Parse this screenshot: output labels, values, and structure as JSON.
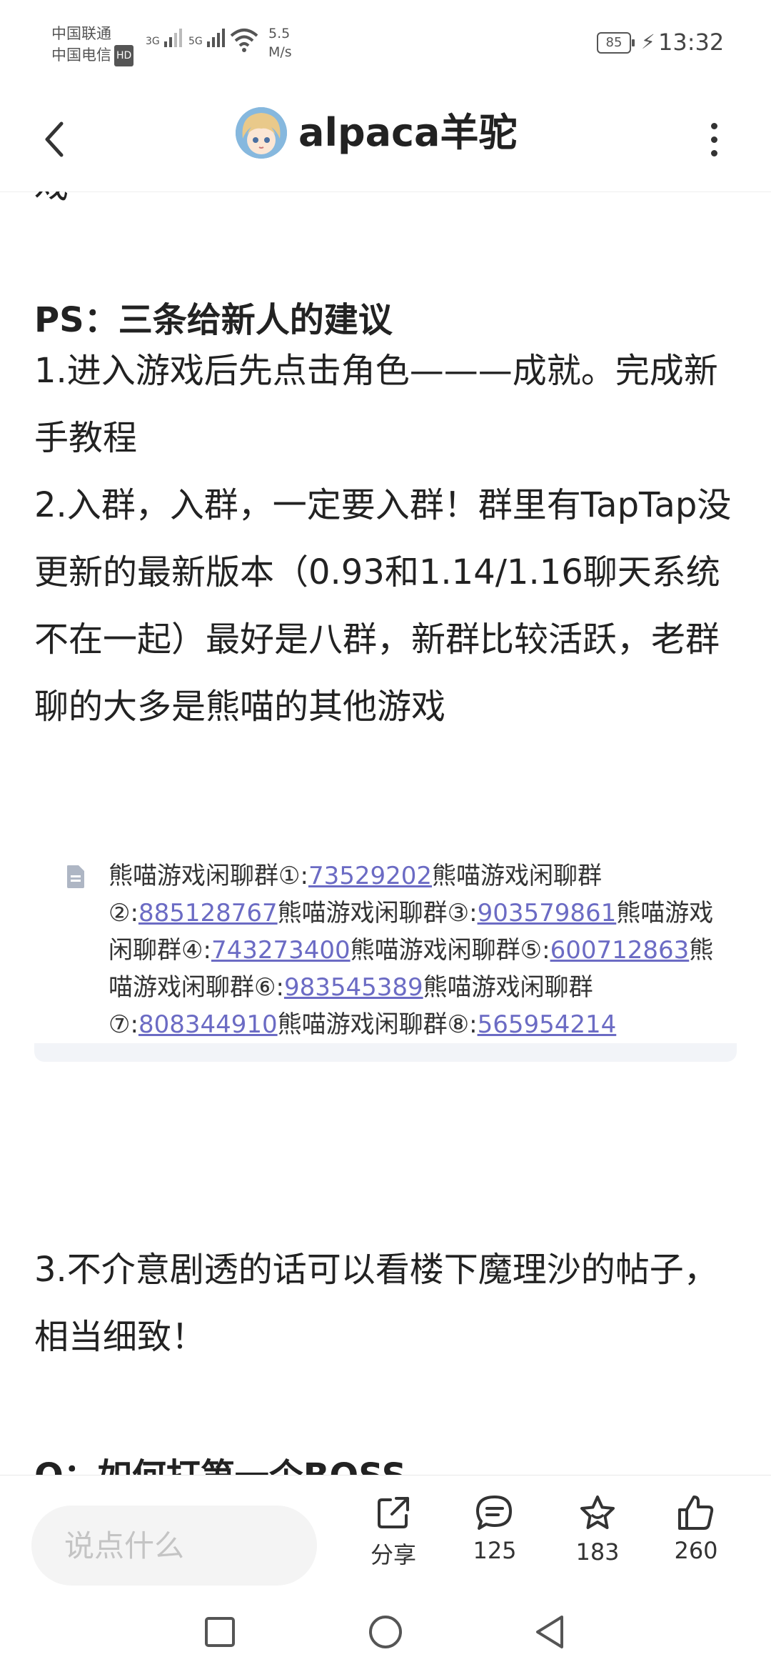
{
  "status_bar": {
    "carrier1": "中国联通",
    "carrier2": "中国电信",
    "hd_badge": "HD",
    "signal1_type": "3G",
    "signal2_type": "5G",
    "net_speed_value": "5.5",
    "net_speed_unit": "M/s",
    "battery": "85",
    "time": "13:32"
  },
  "header": {
    "back_icon": "chevron-left-icon",
    "author_name": "alpaca羊驼",
    "more_icon": "more-vertical-icon"
  },
  "content": {
    "cut_top_char": "戏",
    "section_heading": "PS：三条给新人的建议",
    "para1": "1.进入游戏后先点击角色———成就。完成新手教程",
    "para2": "2.入群，入群，一定要入群！群里有TapTap没更新的最新版本（0.93和1.14/1.16聊天系统不在一起）最好是八群，新群比较活跃，老群聊的大多是熊喵的其他游戏",
    "groups": [
      {
        "label": "熊喵游戏闲聊群①:",
        "id": "73529202"
      },
      {
        "label": "熊喵游戏闲聊群②:",
        "id": "885128767"
      },
      {
        "label": "熊喵游戏闲聊群③:",
        "id": "903579861"
      },
      {
        "label": "熊喵游戏闲聊群④:",
        "id": "743273400"
      },
      {
        "label": "熊喵游戏闲聊群⑤:",
        "id": "600712863"
      },
      {
        "label": "熊喵游戏闲聊群⑥:",
        "id": "983545389"
      },
      {
        "label": "熊喵游戏闲聊群⑦:",
        "id": "808344910"
      },
      {
        "label": "熊喵游戏闲聊群⑧:",
        "id": "565954214"
      }
    ],
    "para3": "3.不介意剧透的话可以看楼下魔理沙的帖子，相当细致！",
    "next_heading": "Q：如何打第一个BOSS"
  },
  "action_bar": {
    "comment_placeholder": "说点什么",
    "share_label": "分享",
    "comments_count": "125",
    "favorites_count": "183",
    "likes_count": "260"
  },
  "colors": {
    "link": "#6b6bc4",
    "text": "#222222",
    "card_bottom": "#f2f4f8"
  }
}
